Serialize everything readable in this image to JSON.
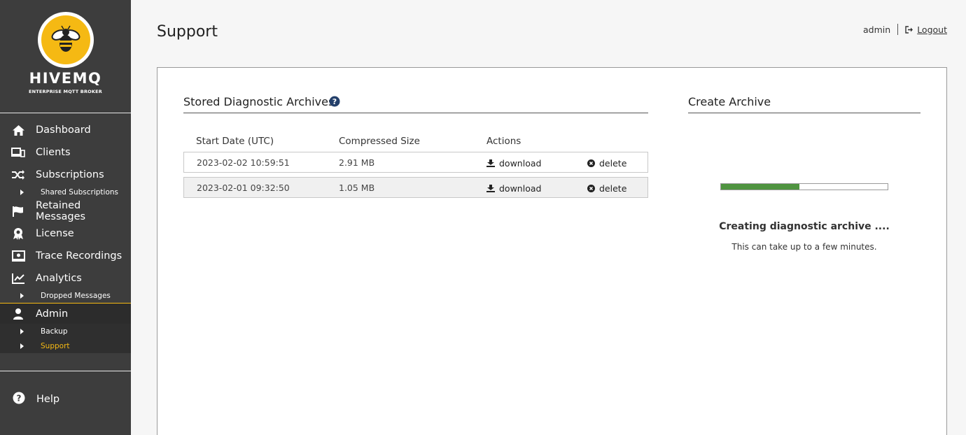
{
  "brand": {
    "name": "HIVEMQ",
    "tagline": "ENTERPRISE MQTT BROKER",
    "accent": "#f5b913"
  },
  "sidebar": {
    "items": [
      {
        "label": "Dashboard",
        "icon": "home-icon"
      },
      {
        "label": "Clients",
        "icon": "clients-icon"
      },
      {
        "label": "Subscriptions",
        "icon": "shuffle-icon"
      },
      {
        "label": "Shared Subscriptions",
        "icon": "caret-right-icon"
      },
      {
        "label": "Retained Messages",
        "icon": "flag-icon"
      },
      {
        "label": "License",
        "icon": "award-icon"
      },
      {
        "label": "Trace Recordings",
        "icon": "recording-icon"
      },
      {
        "label": "Analytics",
        "icon": "chart-line-icon"
      },
      {
        "label": "Dropped Messages",
        "icon": "caret-right-icon"
      },
      {
        "label": "Admin",
        "icon": "user-icon"
      },
      {
        "label": "Backup",
        "icon": "caret-right-icon"
      },
      {
        "label": "Support",
        "icon": "caret-right-icon"
      }
    ],
    "help_label": "Help"
  },
  "header": {
    "title": "Support",
    "user": "admin",
    "logout_label": "Logout"
  },
  "archives": {
    "title": "Stored Diagnostic Archives",
    "columns": [
      "Start Date (UTC)",
      "Compressed Size",
      "Actions"
    ],
    "rows": [
      {
        "date": "2023-02-02 10:59:51",
        "size": "2.91 MB",
        "download": "download",
        "delete": "delete"
      },
      {
        "date": "2023-02-01 09:32:50",
        "size": "1.05 MB",
        "download": "download",
        "delete": "delete"
      }
    ]
  },
  "create": {
    "title": "Create Archive",
    "progress": 0.47,
    "status_title": "Creating diagnostic archive ....",
    "status_sub": "This can take up to a few minutes."
  },
  "colors": {
    "sidebar": "#3d3d3d",
    "progress": "#4f9440"
  }
}
